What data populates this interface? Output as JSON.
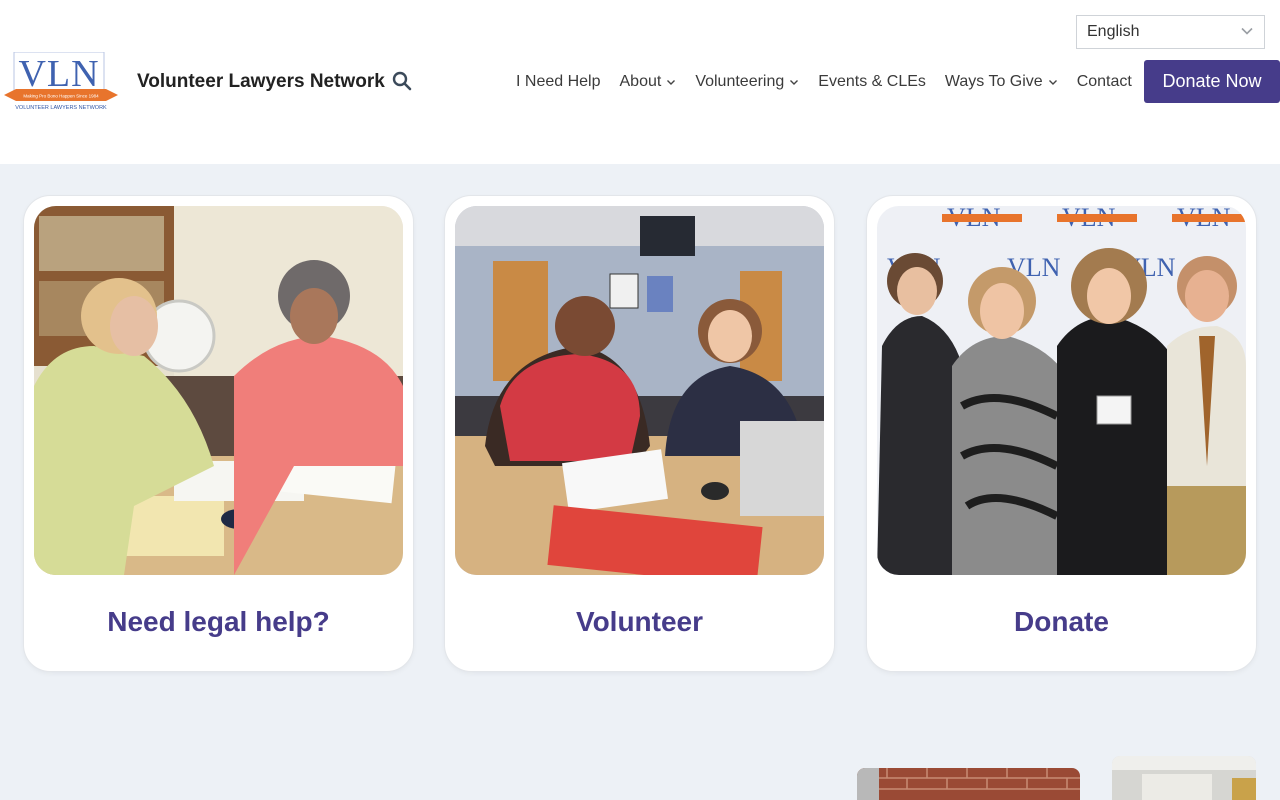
{
  "language": {
    "selected": "English"
  },
  "header": {
    "logo_text": "VLN",
    "logo_tagline": "Making Pro Bono Happen Since 1984",
    "logo_subtext": "VOLUNTEER LAWYERS NETWORK",
    "site_name": "Volunteer Lawyers Network"
  },
  "nav": {
    "items": [
      {
        "label": "I Need Help",
        "has_dropdown": false
      },
      {
        "label": "About",
        "has_dropdown": true
      },
      {
        "label": "Volunteering",
        "has_dropdown": true
      },
      {
        "label": "Events & CLEs",
        "has_dropdown": false
      },
      {
        "label": "Ways To Give",
        "has_dropdown": true
      },
      {
        "label": "Contact",
        "has_dropdown": false
      }
    ],
    "donate_label": "Donate Now"
  },
  "cards": [
    {
      "label": "Need legal help?"
    },
    {
      "label": "Volunteer"
    },
    {
      "label": "Donate"
    }
  ],
  "colors": {
    "brand_purple": "#463c8a",
    "page_background": "#edf1f6",
    "logo_blue": "#2f56a6",
    "logo_orange": "#e8742c"
  }
}
